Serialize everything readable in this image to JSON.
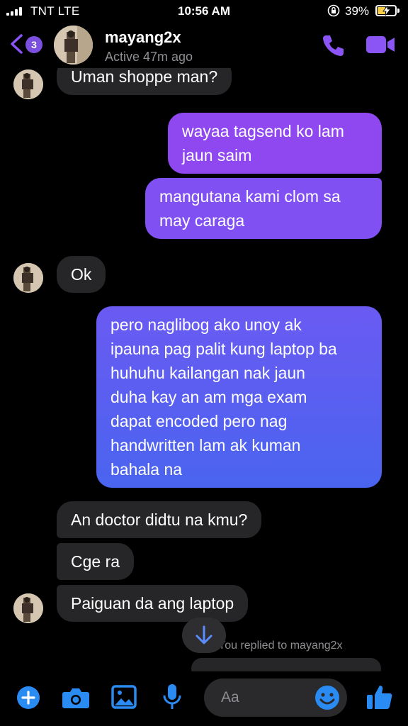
{
  "status_bar": {
    "carrier": "TNT  LTE",
    "time": "10:56 AM",
    "battery": "39%"
  },
  "header": {
    "unread_count": "3",
    "contact_name": "mayang2x",
    "contact_status": "Active 47m ago"
  },
  "messages": [
    {
      "dir": "in",
      "text": "Uman shoppe man?",
      "lines": [
        "Uman shoppe man?"
      ]
    },
    {
      "dir": "out",
      "lines": [
        "wayaa tagsend ko lam",
        "jaun saim"
      ]
    },
    {
      "dir": "out",
      "lines": [
        "mangutana kami clom sa",
        "may caraga"
      ]
    },
    {
      "dir": "in",
      "lines": [
        "Ok"
      ]
    },
    {
      "dir": "out",
      "lines": [
        "pero naglibog ako unoy ak",
        "ipauna pag palit kung laptop ba",
        "huhuhu kailangan nak jaun",
        "duha kay an am mga exam",
        "dapat encoded pero nag",
        "handwritten lam ak kuman",
        "bahala na"
      ]
    },
    {
      "dir": "in",
      "lines": [
        "An doctor didtu na kmu?"
      ]
    },
    {
      "dir": "in",
      "lines": [
        "Cge ra"
      ]
    },
    {
      "dir": "in",
      "lines": [
        "Paiguan da ang laptop"
      ]
    }
  ],
  "reply_notice": "You replied to mayang2x",
  "composer": {
    "placeholder": "Aa"
  },
  "colors": {
    "accent": "#8b54f5",
    "out_top": "#9447f0",
    "out_bottom": "#4a63f0",
    "in_bubble": "#262628"
  },
  "icons": [
    "back-chevron-icon",
    "phone-icon",
    "video-camera-icon",
    "plus-icon",
    "camera-icon",
    "image-icon",
    "microphone-icon",
    "emoji-icon",
    "thumbs-up-icon",
    "arrow-down-icon"
  ]
}
